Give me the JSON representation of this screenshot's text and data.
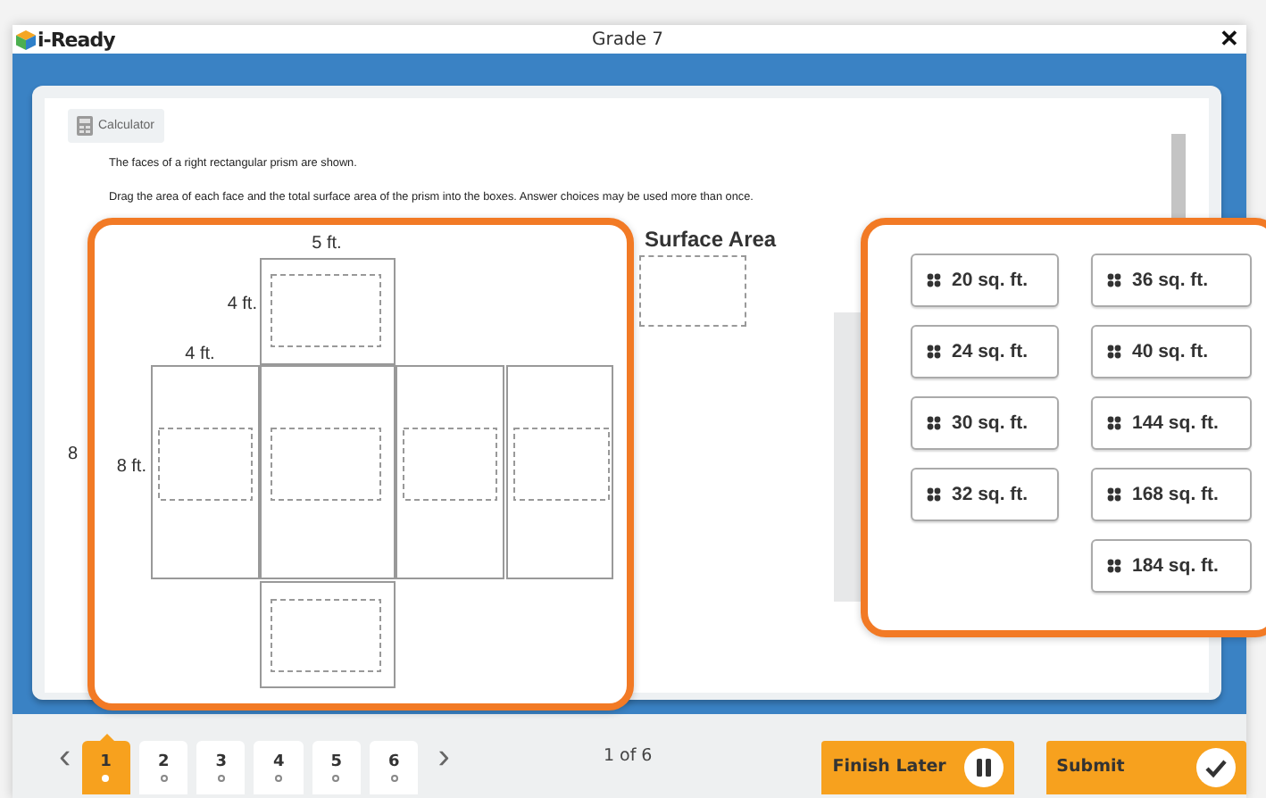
{
  "window": {
    "logo": "i-Ready",
    "title": "Grade 7",
    "close": "✕"
  },
  "question": {
    "calculator_button": "Calculator",
    "prompt_lines": [
      "The faces of a right rectangular prism are shown.",
      "Drag the area of each face and the total surface area of the prism into the boxes. Answer choices may be used more than once."
    ],
    "side_label": "8",
    "surface_area_label": "Surface Area"
  },
  "net": {
    "dimension_labels": [
      "5 ft.",
      "4 ft.",
      "4 ft.",
      "8 ft."
    ]
  },
  "answer_choices": {
    "columns": [
      [
        "20 sq. ft.",
        "24 sq. ft.",
        "30 sq. ft.",
        "32 sq. ft."
      ],
      [
        "36 sq. ft.",
        "40 sq. ft.",
        "144 sq. ft.",
        "168 sq. ft.",
        "184 sq. ft."
      ]
    ]
  },
  "pager": {
    "prev": "‹",
    "next": "›",
    "pages": [
      {
        "label": "1",
        "selected": true
      },
      {
        "label": "2",
        "selected": false
      },
      {
        "label": "3",
        "selected": false
      },
      {
        "label": "4",
        "selected": false
      },
      {
        "label": "5",
        "selected": false
      },
      {
        "label": "6",
        "selected": false
      }
    ],
    "position": "1 of 6"
  },
  "buttons": [
    {
      "label": "Finish Later",
      "kind": "pause"
    },
    {
      "label": "Submit",
      "kind": "check"
    }
  ]
}
